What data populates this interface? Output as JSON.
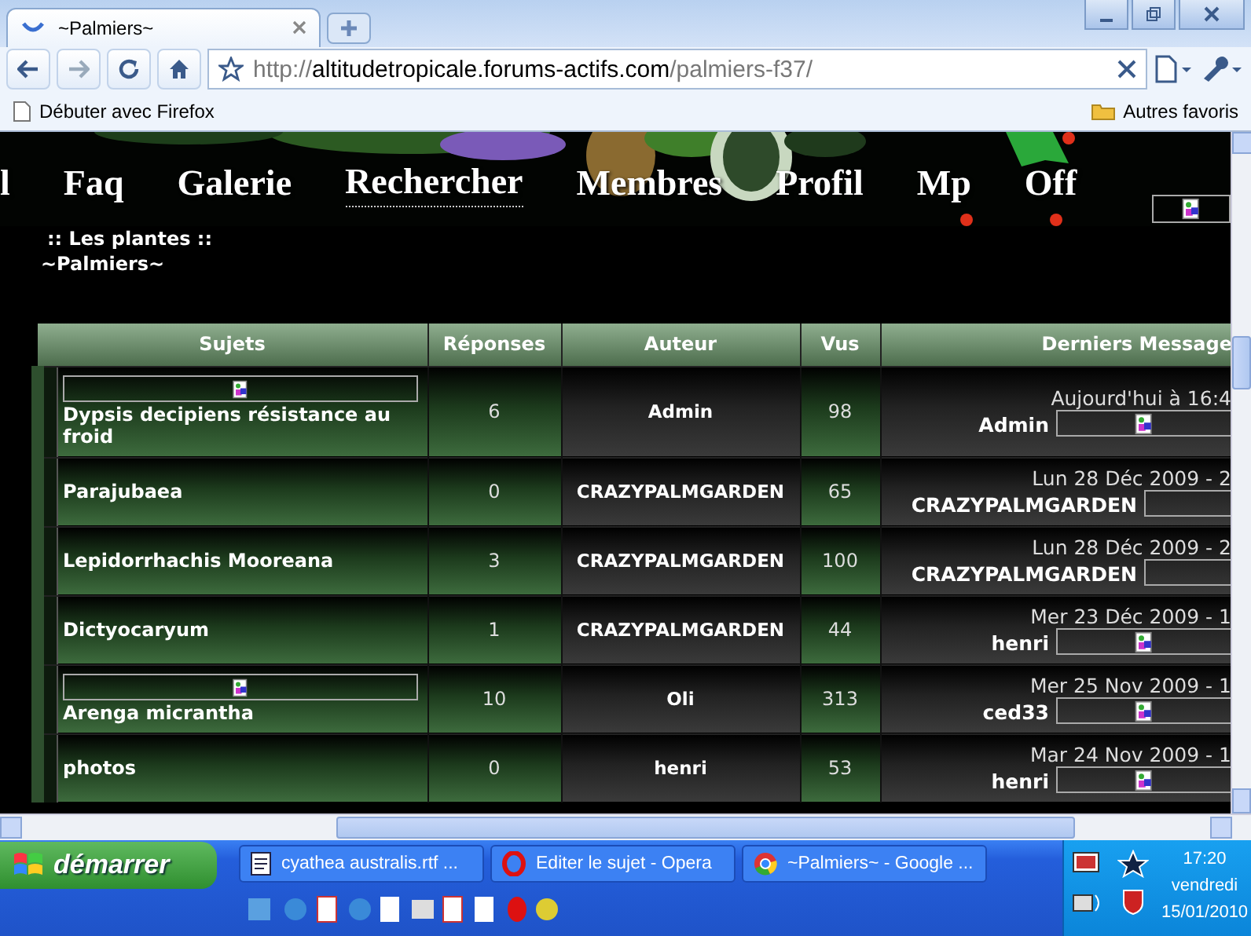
{
  "browser": {
    "tab_title": "~Palmiers~",
    "url_scheme": "http://",
    "url_host": "altitudetropicale.forums-actifs.com",
    "url_path": "/palmiers-f37/",
    "bookmarks": [
      "Débuter avec Firefox"
    ],
    "other_bookmarks": "Autres favoris"
  },
  "nav": [
    {
      "label": "l",
      "selected": false
    },
    {
      "label": "Faq",
      "selected": false
    },
    {
      "label": "Galerie",
      "selected": false
    },
    {
      "label": "Rechercher",
      "selected": true
    },
    {
      "label": "Membres",
      "selected": false
    },
    {
      "label": "Profil",
      "selected": false
    },
    {
      "label": "Mp",
      "selected": false
    },
    {
      "label": "Off",
      "selected": false
    }
  ],
  "breadcrumb": ":: Les plantes ::",
  "forum_title": "~Palmiers~",
  "table": {
    "columns": [
      "Sujets",
      "Réponses",
      "Auteur",
      "Vus",
      "Derniers Message"
    ],
    "rows": [
      {
        "subject": "Dypsis decipiens résistance au froid",
        "subject_image": true,
        "replies": "6",
        "author": "Admin",
        "views": "98",
        "last_date": "Aujourd'hui à 16:4",
        "last_author": "Admin",
        "last_icon": true
      },
      {
        "subject": "Parajubaea",
        "subject_image": false,
        "replies": "0",
        "author": "CRAZYPALMGARDEN",
        "views": "65",
        "last_date": "Lun 28 Déc 2009 - 2",
        "last_author": "CRAZYPALMGARDEN",
        "last_icon": false
      },
      {
        "subject": "Lepidorrhachis Mooreana",
        "subject_image": false,
        "replies": "3",
        "author": "CRAZYPALMGARDEN",
        "views": "100",
        "last_date": "Lun 28 Déc 2009 - 2",
        "last_author": "CRAZYPALMGARDEN",
        "last_icon": false
      },
      {
        "subject": "Dictyocaryum",
        "subject_image": false,
        "replies": "1",
        "author": "CRAZYPALMGARDEN",
        "views": "44",
        "last_date": "Mer 23 Déc 2009 - 1",
        "last_author": "henri",
        "last_icon": true
      },
      {
        "subject": "Arenga micrantha",
        "subject_image": true,
        "replies": "10",
        "author": "Oli",
        "views": "313",
        "last_date": "Mer 25 Nov 2009 - 1",
        "last_author": "ced33",
        "last_icon": true
      },
      {
        "subject": "photos",
        "subject_image": false,
        "replies": "0",
        "author": "henri",
        "views": "53",
        "last_date": "Mar 24 Nov 2009 - 1",
        "last_author": "henri",
        "last_icon": true
      }
    ]
  },
  "taskbar": {
    "start": "démarrer",
    "tasks": [
      {
        "label": "cyathea australis.rtf ...",
        "kind": "document"
      },
      {
        "label": "Editer le sujet - Opera",
        "kind": "opera"
      },
      {
        "label": "~Palmiers~ - Google ...",
        "kind": "chrome"
      }
    ],
    "time": "17:20",
    "day": "vendredi",
    "date": "15/01/2010"
  }
}
